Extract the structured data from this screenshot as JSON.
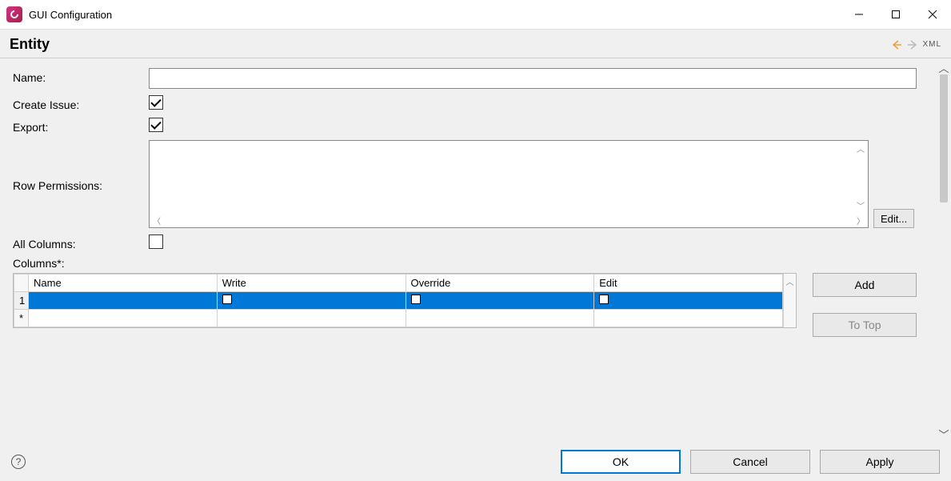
{
  "window": {
    "title": "GUI Configuration"
  },
  "header": {
    "title": "Entity",
    "xml_label": "XML"
  },
  "form": {
    "name_label": "Name:",
    "name_value": "",
    "create_issue_label": "Create Issue:",
    "create_issue_checked": true,
    "export_label": "Export:",
    "export_checked": true,
    "row_permissions_label": "Row Permissions:",
    "row_permissions_value": "",
    "edit_button": "Edit...",
    "all_columns_label": "All Columns:",
    "all_columns_checked": false,
    "columns_label": "Columns*:"
  },
  "columns_table": {
    "headers": [
      "Name",
      "Write",
      "Override",
      "Edit"
    ],
    "rows": [
      {
        "num": "1",
        "name": "",
        "write": false,
        "override": false,
        "edit": false
      }
    ],
    "new_row_marker": "*"
  },
  "side_buttons": {
    "add": "Add",
    "to_top": "To Top"
  },
  "footer": {
    "ok": "OK",
    "cancel": "Cancel",
    "apply": "Apply"
  }
}
